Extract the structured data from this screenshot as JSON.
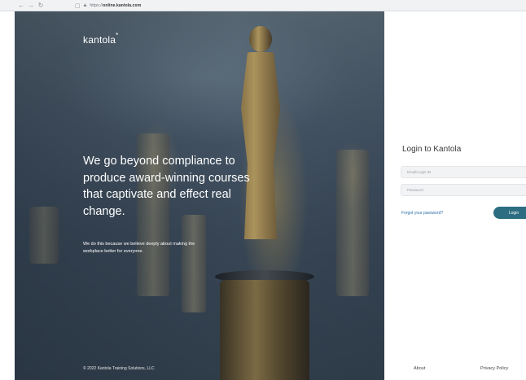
{
  "browser": {
    "url_prefix": "https://",
    "url_domain": "online.kantola.com",
    "nav_back": "←",
    "nav_forward": "→",
    "nav_reload": "↻"
  },
  "hero": {
    "logo": "kantola",
    "logo_mark": "*",
    "headline": "We go beyond compliance to produce award-winning courses that captivate and effect real change.",
    "subtext": "We do this because we believe deeply about making the workplace better for everyone.",
    "copyright": "© 2022 Kantola Training Solutions, LLC"
  },
  "login": {
    "title": "Login to Kantola",
    "email_placeholder": "Email/Login ID",
    "password_placeholder": "Password",
    "forgot_label": "Forgot your password?",
    "login_label": "Login"
  },
  "footer": {
    "about_label": "About",
    "privacy_label": "Privacy Policy"
  },
  "colors": {
    "login_button": "#2c6d82",
    "link": "#2a6fa8"
  }
}
